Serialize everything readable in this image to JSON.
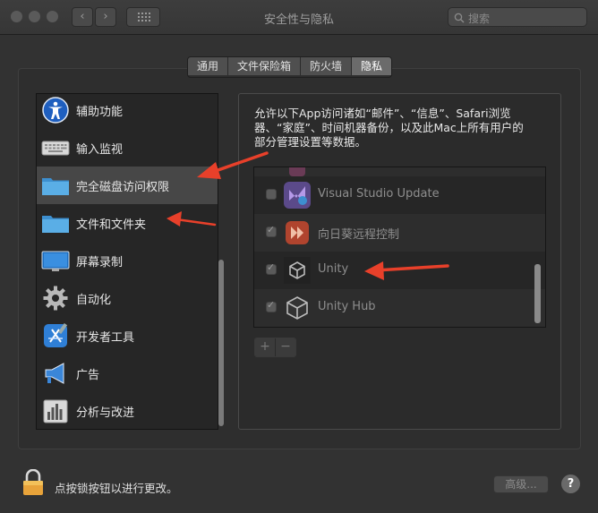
{
  "window": {
    "title": "安全性与隐私"
  },
  "search": {
    "placeholder": "搜索"
  },
  "tabs": [
    {
      "label": "通用",
      "active": false
    },
    {
      "label": "文件保险箱",
      "active": false
    },
    {
      "label": "防火墙",
      "active": false
    },
    {
      "label": "隐私",
      "active": true
    }
  ],
  "sidebar": {
    "items": [
      {
        "label": "辅助功能",
        "icon": "accessibility-icon"
      },
      {
        "label": "输入监视",
        "icon": "keyboard-icon"
      },
      {
        "label": "完全磁盘访问权限",
        "icon": "folder-icon",
        "selected": true
      },
      {
        "label": "文件和文件夹",
        "icon": "folder-icon"
      },
      {
        "label": "屏幕录制",
        "icon": "display-icon"
      },
      {
        "label": "自动化",
        "icon": "gear-icon"
      },
      {
        "label": "开发者工具",
        "icon": "xcode-icon"
      },
      {
        "label": "广告",
        "icon": "megaphone-icon"
      },
      {
        "label": "分析与改进",
        "icon": "chart-icon"
      }
    ]
  },
  "main": {
    "description_lines": [
      "允许以下App访问诸如“邮件”、“信息”、Safari浏览",
      "器、“家庭”、时间机器备份，以及此Mac上所有用户的",
      "部分管理设置等数据。"
    ],
    "apps": [
      {
        "label": "Visual Studio Update",
        "checked": false,
        "icon": "visual-studio-icon"
      },
      {
        "label": "向日葵远程控制",
        "checked": true,
        "icon": "sunlogin-icon"
      },
      {
        "label": "Unity",
        "checked": true,
        "icon": "unity-icon"
      },
      {
        "label": "Unity Hub",
        "checked": true,
        "icon": "unity-hub-icon"
      }
    ],
    "add_label": "+",
    "remove_label": "−"
  },
  "footer": {
    "lock_message": "点按锁按钮以进行更改。",
    "advanced_label": "高级...",
    "help_label": "?"
  },
  "colors": {
    "annotation_arrow": "#e8402a",
    "window_bg": "#323232"
  }
}
